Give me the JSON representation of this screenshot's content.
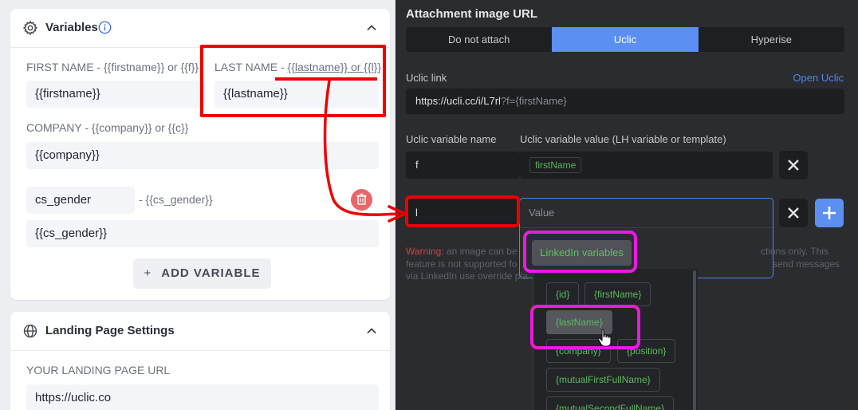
{
  "variables_card": {
    "title": "Variables",
    "first_name_label": "FIRST NAME - {{firstname}} or {{f}}",
    "first_name_value": "{{firstname}}",
    "last_name_label_prefix": "LAST NAME - ",
    "last_name_label_hint": "{{lastname}} or {{l}}",
    "last_name_value": "{{lastname}}",
    "company_label": "COMPANY - {{company}} or {{c}}",
    "company_value": "{{company}}",
    "custom_var_name": "cs_gender",
    "custom_var_hint": "- {{cs_gender}}",
    "custom_var_value": "{{cs_gender}}",
    "add_variable_label": "ADD VARIABLE"
  },
  "landing_card": {
    "title": "Landing Page Settings",
    "url_label": "YOUR LANDING PAGE URL",
    "url_value": "https://uclic.co"
  },
  "attachment": {
    "title": "Attachment image URL",
    "tabs": [
      "Do not attach",
      "Uclic",
      "Hyperise"
    ],
    "active_tab": "Uclic",
    "uclic_link_label": "Uclic link",
    "open_uclic_link": "Open Uclic",
    "uclic_link_value": "https://ucli.cc/i/L7rl",
    "uclic_link_suffix": "?f={firstName}",
    "var_name_header": "Uclic variable name",
    "var_value_header": "Uclic variable value (LH variable or template)",
    "row1_name": "f",
    "row1_value": "firstName",
    "row2_name": "l",
    "row2_placeholder": "Value",
    "warning_prefix": "Warning:",
    "warning_line1_start": "an image can be",
    "warning_line1_end": "ctions only. This",
    "warning_line2_start": "feature is not supported fo",
    "warning_line2_end": "send messages",
    "warning_line3": "via LinkedIn use override pla",
    "linkedin_variables_label": "LinkedIn variables",
    "chips": [
      "{id}",
      "{firstName}",
      "{lastName}",
      "{company}",
      "{position}",
      "{mutualFirstFullName}",
      "{mutualSecondFullName}"
    ]
  },
  "colors": {
    "accent": "#5b8ff1",
    "highlight_red": "#ee0000",
    "highlight_magenta": "#ea1ae2",
    "variable_green": "#5aba5e"
  },
  "icons": [
    "gear-icon",
    "info-icon",
    "chevron-up-icon",
    "globe-icon",
    "trash-icon",
    "close-icon",
    "plus-icon",
    "cursor-hand-icon"
  ]
}
